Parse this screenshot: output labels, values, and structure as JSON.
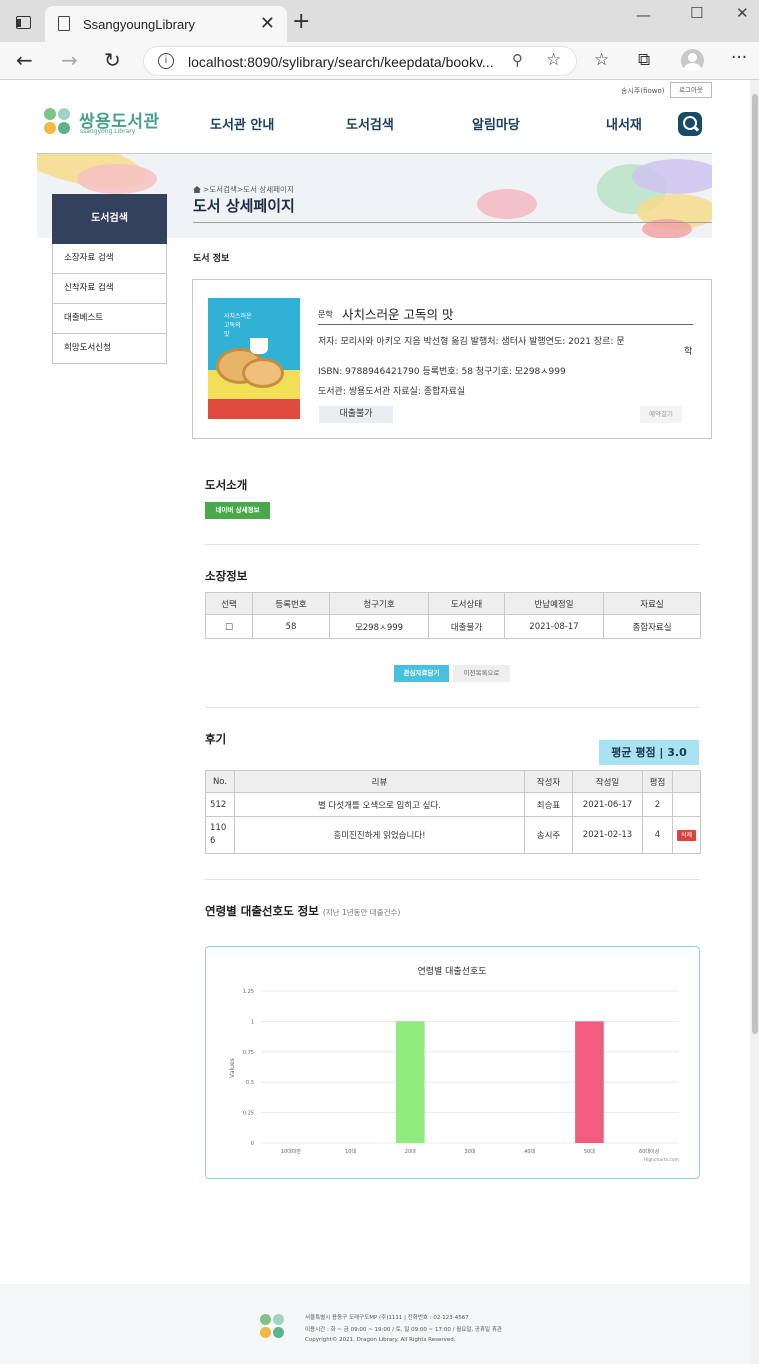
{
  "browser": {
    "tab_title": "SsangyoungLibrary",
    "url": "localhost:8090/sylibrary/search/keepdata/bookv...",
    "new_tab": "+",
    "tab_close": "✕"
  },
  "header": {
    "user_name": "송시주(fiowo)",
    "logout": "로그아웃",
    "logo_text": "쌍용도서관",
    "logo_sub": "ssangyong Library",
    "gnb": [
      "도서관 안내",
      "도서검색",
      "알림마당",
      "내서재"
    ]
  },
  "side_nav": {
    "title": "도서검색",
    "items": [
      "소장자료 검색",
      "신착자료 검색",
      "대출베스트",
      "희망도서신청"
    ]
  },
  "page": {
    "breadcrumb": ">도서검색>도서 상세페이지",
    "title": "도서 상세페이지",
    "section_label": "도서 정보"
  },
  "book": {
    "cover_title": "사치스러운\n고독의\n맛",
    "genre": "문학",
    "title": "사치스러운 고독의 맛",
    "meta_line1": "저자: 모리사와 아키오 지음 박선형 옮김  발행처: 샘터사  발행연도: 2021  장르: 문",
    "meta_line1b": "학",
    "meta_line2": "ISBN: 9788946421790  등록번호: 58  청구기호: 모298ㅅ999",
    "meta_line3": "도서관: 쌍용도서관  자료실: 종합자료실",
    "btn_unavailable": "대출불가",
    "btn_reserve": "예약걸기"
  },
  "intro": {
    "heading": "도서소개",
    "naver_btn": "네이버 상세정보"
  },
  "holdings": {
    "heading": "소장정보",
    "columns": [
      "선택",
      "등록번호",
      "청구기호",
      "도서상태",
      "반납예정일",
      "자료실"
    ],
    "rows": [
      [
        "□",
        "58",
        "모298ㅅ999",
        "대출불가",
        "2021-08-17",
        "종합자료실"
      ]
    ],
    "btn_keep": "관심자료담기",
    "btn_back": "이전목록으로"
  },
  "reviews": {
    "heading": "후기",
    "avg_rating": "평균 평점 | 3.0",
    "columns": [
      "No.",
      "리뷰",
      "작성자",
      "작성일",
      "평점",
      ""
    ],
    "rows": [
      {
        "no": "512",
        "text": "별 다섯개를 오색으로 입히고 싶다.",
        "author": "최승표",
        "date": "2021-06-17",
        "score": "2",
        "action": ""
      },
      {
        "no": "110\n6",
        "text": "흥미진진하게 읽었습니다!",
        "author": "송시주",
        "date": "2021-02-13",
        "score": "4",
        "action": "삭제"
      }
    ]
  },
  "age_section": {
    "heading": "연령별 대출선호도 정보",
    "sub": "(지난 1년동안 대출건수)"
  },
  "chart_data": {
    "type": "bar",
    "title": "연령별 대출선호도",
    "ylabel": "Values",
    "xlabel": "",
    "categories": [
      "10대미만",
      "10대",
      "20대",
      "30대",
      "40대",
      "50대",
      "60대이상"
    ],
    "values": [
      0,
      0,
      1,
      0,
      0,
      1,
      0
    ],
    "bar_colors": [
      "#7cb5ec",
      "#434348",
      "#90ed7d",
      "#f7a35c",
      "#8085e9",
      "#f15c80",
      "#e4d354"
    ],
    "yticks": [
      "0",
      "0.25",
      "0.5",
      "0.75",
      "1",
      "1.25"
    ],
    "ylim": [
      0,
      1.25
    ],
    "credit": "Highcharts.com",
    "grid": true,
    "legend": "none"
  },
  "footer": {
    "line1": "서울특별시 용동구 도래구도MP (주)1111 | 전화번호 : 02-123-4567",
    "line2": "이용시간 : 화 ~ 금 09:00 ~ 19:00 / 토, 일 09:00 ~ 17:00 / 월요일, 공휴일 휴관",
    "line3": "Copyright© 2021. Dragon Library. All Rights Reserved."
  }
}
